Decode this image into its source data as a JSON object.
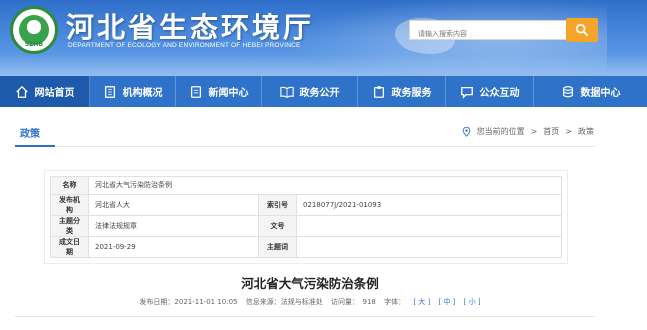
{
  "header": {
    "title": "河北省生态环境厅",
    "subtitle": "DEPARTMENT OF ECOLOGY AND ENVIRONMENT OF HEBEI PROVINCE",
    "logo_text": "SZHB",
    "search_placeholder": "请输入搜索内容"
  },
  "nav": {
    "items": [
      {
        "label": "网站首页",
        "icon": "home-icon"
      },
      {
        "label": "机构概况",
        "icon": "building-icon"
      },
      {
        "label": "新闻中心",
        "icon": "document-icon"
      },
      {
        "label": "政务公开",
        "icon": "book-icon"
      },
      {
        "label": "政务服务",
        "icon": "clipboard-icon"
      },
      {
        "label": "公众互动",
        "icon": "chat-icon"
      },
      {
        "label": "数据中心",
        "icon": "database-icon"
      }
    ]
  },
  "breadcrumb": {
    "section": "政策",
    "prefix": "您当前的位置",
    "sep": ">",
    "home": "首页",
    "current": "政策"
  },
  "info": {
    "name_label": "名称",
    "name_value": "河北省大气污染防治条例",
    "org_label": "发布机构",
    "org_value": "河北省人大",
    "index_label": "索引号",
    "index_value": "0218077J/2021-01093",
    "topic_label": "主题分类",
    "topic_value": "法律法规规章",
    "docno_label": "文号",
    "docno_value": "",
    "date_label": "成文日期",
    "date_value": "2021-09-29",
    "keyword_label": "主题词",
    "keyword_value": ""
  },
  "article": {
    "title": "河北省大气污染防治条例",
    "publish_date": "发布日期：2021-11-01 10:05",
    "source": "信息来源：法规与标准处",
    "views": "访问量：　918",
    "font_label": "字体：",
    "font_large": "[ 大 ]",
    "font_medium": "[ 中 ]",
    "font_small": "[ 小 ]"
  },
  "colors": {
    "nav": "#2e72c9",
    "accent": "#f3a52a"
  }
}
